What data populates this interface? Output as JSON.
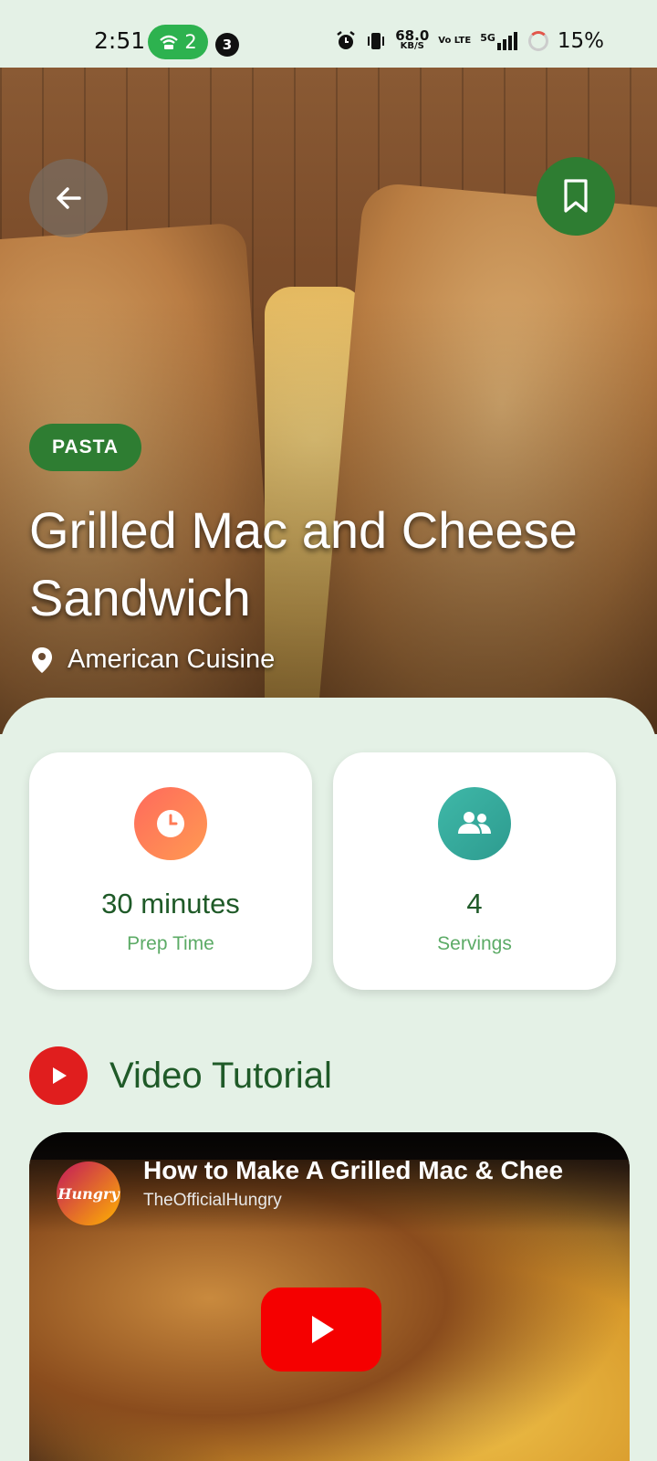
{
  "status_bar": {
    "time": "2:51",
    "hotspot_count": "2",
    "notification_count": "3",
    "net_speed": "68.0",
    "net_speed_unit": "KB/S",
    "volte": "Vo LTE",
    "signal": "5G",
    "battery": "15%"
  },
  "hero": {
    "category": "PASTA",
    "title": "Grilled Mac and Cheese Sandwich",
    "cuisine": "American Cuisine",
    "back_icon": "arrow-left-icon",
    "bookmark_icon": "bookmark-icon"
  },
  "stats": {
    "prep": {
      "value": "30 minutes",
      "label": "Prep Time",
      "icon": "clock-icon"
    },
    "servings": {
      "value": "4",
      "label": "Servings",
      "icon": "people-icon"
    }
  },
  "video": {
    "heading": "Video Tutorial",
    "title": "How to Make A Grilled Mac & Chee",
    "channel": "TheOfficialHungry",
    "channel_avatar_text": "Hungry"
  },
  "colors": {
    "primary_green": "#2e7d32",
    "background": "#e4f1e6",
    "youtube_red": "#f50000"
  }
}
